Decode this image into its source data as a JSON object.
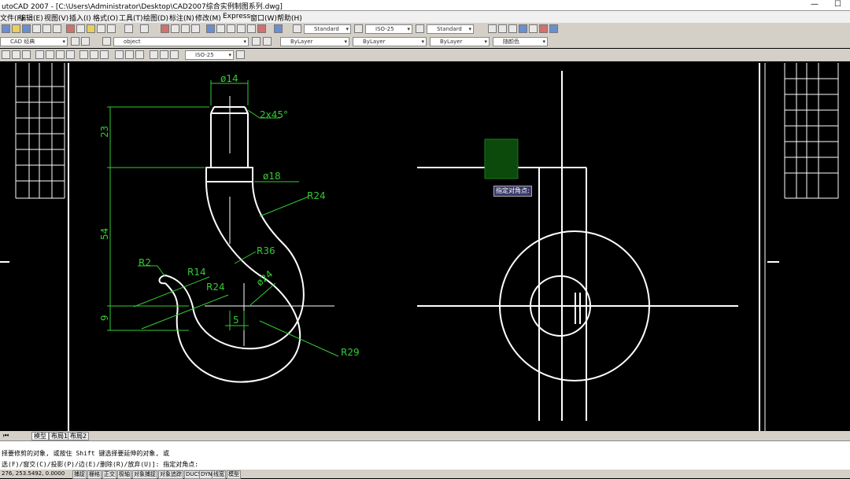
{
  "app": {
    "title": "utoCAD 2007 - [C:\\Users\\Administrator\\Desktop\\CAD2007综合实例制图系列.dwg]",
    "win_min": "—",
    "win_max": "☐"
  },
  "menu": [
    "文件(F)",
    "编辑(E)",
    "视图(V)",
    "插入(I)",
    "格式(O)",
    "工具(T)",
    "绘图(D)",
    "标注(N)",
    "修改(M)",
    "Express",
    "窗口(W)",
    "帮助(H)"
  ],
  "toolbar": {
    "text_style": "Standard",
    "dim_style": "ISO-25",
    "table_style": "Standard",
    "workspace": "CAD 经典",
    "layer": "object",
    "color": "ByLayer",
    "linetype": "ByLayer",
    "lineweight": "ByLayer",
    "plotstyle": "随颜色",
    "dim_style2": "ISO-25"
  },
  "drawing": {
    "dims": {
      "d14": "ø14",
      "chamfer": "2x45°",
      "h23": "23",
      "d18": "ø18",
      "r24a": "R24",
      "h54": "54",
      "r36": "R36",
      "r2": "R2",
      "r14": "R14",
      "r24b": "R24",
      "d24": "ø24",
      "h9": "9",
      "w5": "5",
      "r29": "R29"
    },
    "crosshair_tooltip": "指定对角点:"
  },
  "layout_tabs": [
    "模型",
    "布局1",
    "布局2"
  ],
  "command_lines": [
    "择要修剪的对象, 或按住 Shift 键选择要延伸的对象, 或",
    "选(F)/窗交(C)/投影(P)/边(E)/删除(R)/放弃(U)]:  指定对角点:"
  ],
  "status": {
    "coords": "276, 253.5492, 0.0000",
    "buttons": [
      "捕捉",
      "栅格",
      "正交",
      "极轴",
      "对象捕捉",
      "对象追踪",
      "DUCS",
      "DYN",
      "线宽",
      "模型"
    ]
  },
  "colors": {
    "canvas": "#000000",
    "geometry": "#ffffff",
    "dimension": "#33cc33",
    "selection_window": "#0b4a0b"
  }
}
